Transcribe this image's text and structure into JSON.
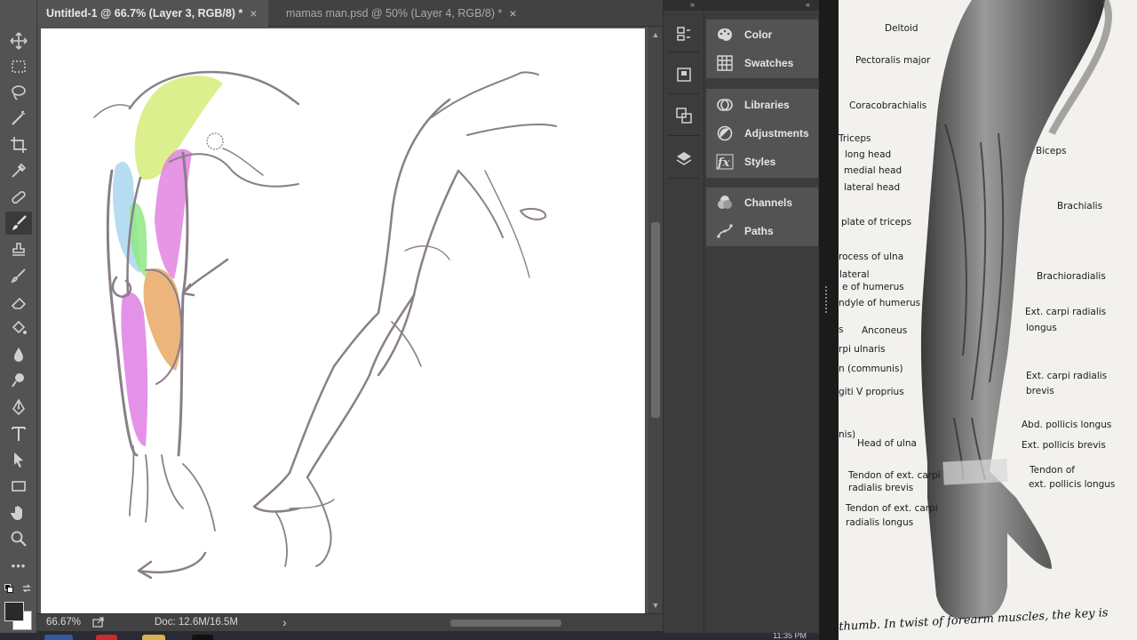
{
  "tabs": [
    {
      "label": "Untitled-1 @ 66.7% (Layer 3, RGB/8) *",
      "close": "×",
      "active": true
    },
    {
      "label": "mamas man.psd @ 50% (Layer 4, RGB/8) *",
      "close": "×",
      "active": false
    }
  ],
  "toolbar": {
    "tools": [
      "move-icon",
      "marquee-icon",
      "lasso-icon",
      "quick-select-icon",
      "crop-icon",
      "eyedropper-icon",
      "healing-brush-icon",
      "brush-icon",
      "clone-stamp-icon",
      "history-brush-icon",
      "eraser-icon",
      "paint-bucket-icon",
      "blur-icon",
      "dodge-icon",
      "pen-icon",
      "type-icon",
      "path-select-icon",
      "rectangle-icon",
      "hand-icon",
      "zoom-icon",
      "more-tools-icon"
    ],
    "active_tool": "brush-icon",
    "more_label": "•••",
    "foreground_color": "#2a2a2a",
    "background_color": "#ffffff"
  },
  "status": {
    "zoom": "66.67%",
    "doc": "Doc: 12.6M/16.5M",
    "arrow": "›"
  },
  "panels": {
    "collapse_label": "«",
    "groups": [
      {
        "items": [
          {
            "label": "Color",
            "icon": "color-icon"
          },
          {
            "label": "Swatches",
            "icon": "swatches-icon"
          }
        ]
      },
      {
        "items": [
          {
            "label": "Libraries",
            "icon": "libraries-icon"
          },
          {
            "label": "Adjustments",
            "icon": "adjustments-icon"
          },
          {
            "label": "Styles",
            "icon": "styles-icon"
          }
        ]
      },
      {
        "items": [
          {
            "label": "Channels",
            "icon": "channels-icon"
          },
          {
            "label": "Paths",
            "icon": "paths-icon"
          }
        ]
      }
    ]
  },
  "dock": {
    "collapse_label": "»",
    "icons": [
      "history-icon",
      "properties-icon",
      "layer-comps-icon",
      "layers-icon"
    ]
  },
  "reference": {
    "labels": [
      "Deltoid",
      "Pectoralis major",
      "Coracobrachialis",
      "Triceps",
      "long head",
      "medial head",
      "lateral head",
      "plate of triceps",
      "rocess of ulna",
      "lateral",
      "e of humerus",
      "ndyle of humerus",
      "Anconeus",
      "s",
      "rpi ulnaris",
      "n (communis)",
      "giti V proprius",
      "nis)",
      "Head of ulna",
      "Tendon of ext. carpi",
      "radialis brevis",
      "Tendon of ext. carpi",
      "radialis longus",
      "Biceps",
      "Brachialis",
      "Brachioradialis",
      "Ext. carpi radialis",
      "longus",
      "Ext. carpi radialis",
      "brevis",
      "Abd. pollicis longus",
      "Ext. pollicis brevis",
      "Tendon of",
      "ext. pollicis longus"
    ],
    "caption": "thumb. In twist of forearm muscles, the key is"
  },
  "taskbar": {
    "clock": "11:35 PM"
  },
  "colors": {
    "shoulder": "#d6ec7a",
    "bicep": "#e383e0",
    "triceps": "#a9d6ee",
    "brachialis": "#8fe985",
    "forearm_orange": "#e8a864",
    "forearm_pink": "#df7fe4",
    "sketch_line": "#8a7f88"
  }
}
